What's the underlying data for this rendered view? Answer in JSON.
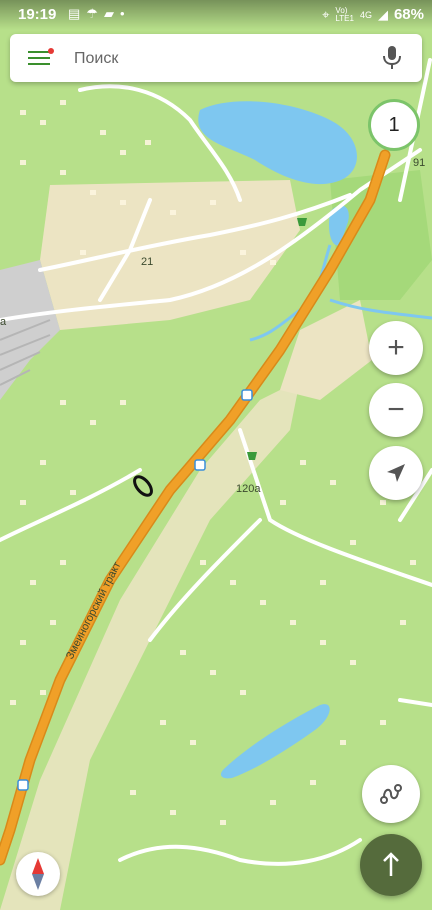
{
  "status_bar": {
    "time": "19:19",
    "notification_icons": [
      "message-icon",
      "umbrella-icon",
      "folder-icon",
      "dot-icon"
    ],
    "network_label_top": "Vo)",
    "network_label_bottom": "LTE1",
    "signal_label": "4G",
    "battery": "68%"
  },
  "search": {
    "placeholder": "Поиск"
  },
  "map": {
    "road_name": "Змеиногорский тракт",
    "labels": {
      "house_21": "21",
      "house_120a": "120а",
      "house_91": "91",
      "edge_a": "а"
    },
    "colors": {
      "land": "#b7e08a",
      "residential": "#ece4c3",
      "main_road": "#f0a028",
      "water": "#7ec7f0",
      "forest": "#a5d97a",
      "buildings": "#fdf6e0"
    }
  },
  "controls": {
    "layer_count": "1",
    "zoom_in_icon": "plus-icon",
    "zoom_out_icon": "minus-icon",
    "locate_icon": "location-arrow-icon",
    "routes_icon": "route-icon",
    "navigate_icon": "arrow-up-icon",
    "compass_icon": "compass-icon"
  }
}
